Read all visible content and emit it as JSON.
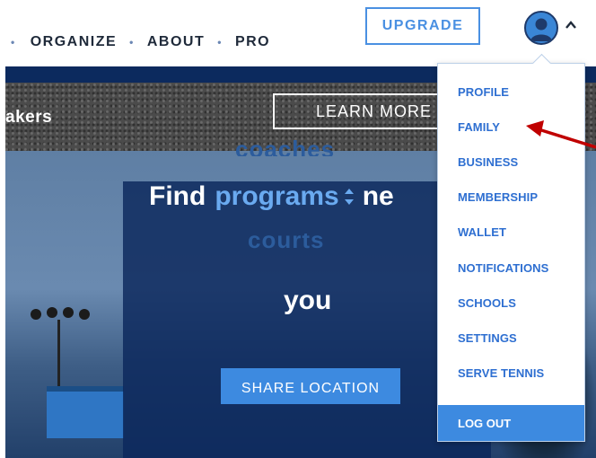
{
  "header": {
    "nav": [
      {
        "label": "ORGANIZE"
      },
      {
        "label": "ABOUT"
      },
      {
        "label": "PRO"
      }
    ],
    "upgrade_label": "UPGRADE",
    "avatar_icon": "user-avatar-icon",
    "caret_icon": "chevron-up-icon"
  },
  "hero": {
    "banner_text": "akers",
    "learn_more_label": "LEARN MORE",
    "ghost_top": "coaches",
    "headline_prefix": "Find",
    "headline_keyword": "programs",
    "headline_suffix": "ne",
    "ghost_bottom": "courts",
    "headline_line2": "you",
    "share_label": "SHARE LOCATION"
  },
  "user_menu": {
    "items": [
      {
        "label": "PROFILE"
      },
      {
        "label": "FAMILY"
      },
      {
        "label": "BUSINESS"
      },
      {
        "label": "MEMBERSHIP"
      },
      {
        "label": "WALLET"
      },
      {
        "label": "NOTIFICATIONS"
      },
      {
        "label": "SCHOOLS"
      },
      {
        "label": "SETTINGS"
      },
      {
        "label": "SERVE TENNIS"
      }
    ],
    "logout_label": "LOG OUT"
  },
  "colors": {
    "accent": "#4a90e2",
    "menu_text": "#2e6fd1",
    "annotation_arrow": "#c00000",
    "nav_text": "#1f2a3a"
  }
}
